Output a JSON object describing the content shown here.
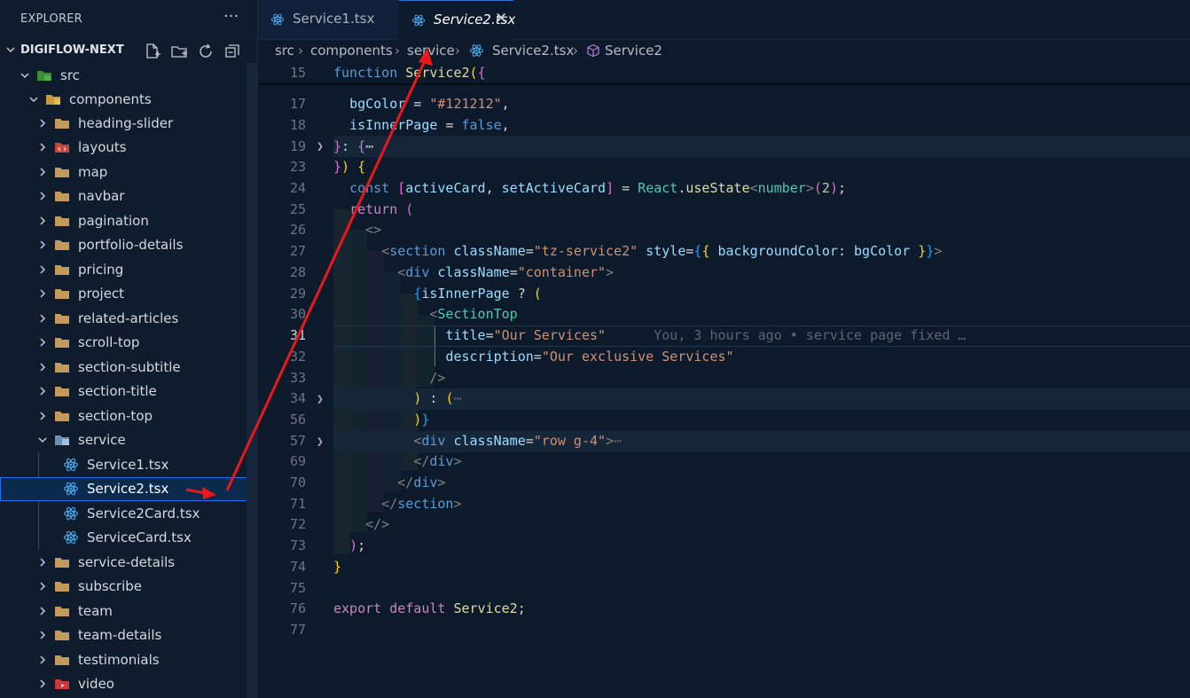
{
  "explorer": {
    "title": "EXPLORER",
    "more": "···",
    "project": "DIGIFLOW-NEXT"
  },
  "tree": [
    {
      "label": "src",
      "icon": "src-folder-icon"
    },
    {
      "label": "components",
      "icon": "components-folder-icon"
    },
    {
      "label": "heading-slider"
    },
    {
      "label": "layouts"
    },
    {
      "label": "map"
    },
    {
      "label": "navbar"
    },
    {
      "label": "pagination"
    },
    {
      "label": "portfolio-details"
    },
    {
      "label": "pricing"
    },
    {
      "label": "project"
    },
    {
      "label": "related-articles"
    },
    {
      "label": "scroll-top"
    },
    {
      "label": "section-subtitle"
    },
    {
      "label": "section-title"
    },
    {
      "label": "section-top"
    },
    {
      "label": "service"
    },
    {
      "label": "Service1.tsx"
    },
    {
      "label": "Service2.tsx"
    },
    {
      "label": "Service2Card.tsx"
    },
    {
      "label": "ServiceCard.tsx"
    },
    {
      "label": "service-details"
    },
    {
      "label": "subscribe"
    },
    {
      "label": "team"
    },
    {
      "label": "team-details"
    },
    {
      "label": "testimonials"
    },
    {
      "label": "video"
    }
  ],
  "tabs": [
    {
      "label": "Service1.tsx"
    },
    {
      "label": "Service2.tsx",
      "close": "✕"
    }
  ],
  "breadcrumb": {
    "src": "src",
    "components": "components",
    "service": "service",
    "file": "Service2.tsx",
    "symbol": "Service2",
    "sep": "›"
  },
  "editor": {
    "line_numbers": [
      "15",
      "17",
      "18",
      "19",
      "23",
      "24",
      "25",
      "26",
      "27",
      "28",
      "29",
      "30",
      "31",
      "32",
      "33",
      "34",
      "56",
      "57",
      "69",
      "70",
      "71",
      "72",
      "73",
      "74",
      "75",
      "76",
      "77"
    ],
    "fold_ellipsis": "⋯",
    "blame": "You, 3 hours ago • service page fixed …"
  },
  "colors": {
    "annotation_arrow": "#e8191c",
    "selection_outline": "#1f6feb"
  }
}
